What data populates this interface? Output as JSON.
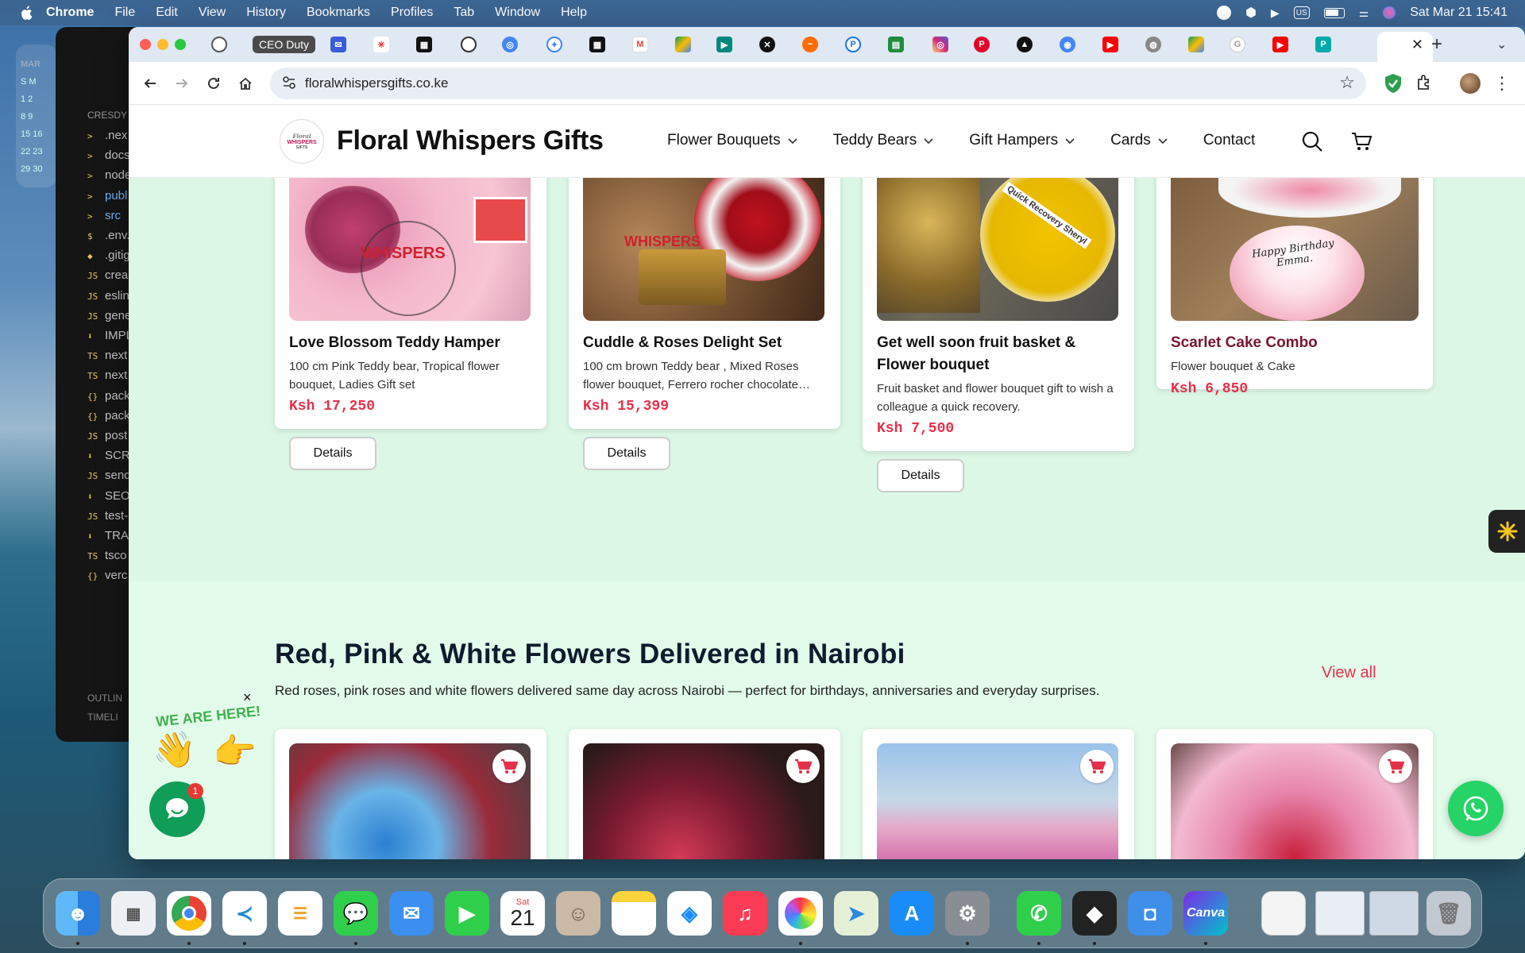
{
  "menubar": {
    "app_name": "Chrome",
    "items": [
      "File",
      "Edit",
      "View",
      "History",
      "Bookmarks",
      "Profiles",
      "Tab",
      "Window",
      "Help"
    ],
    "clock": "Sat Mar 21  15:41",
    "input_source": "US"
  },
  "editor_window": {
    "section_label": "CRESDY",
    "files": [
      {
        "tag": ">",
        "name": ".nex"
      },
      {
        "tag": ">",
        "name": "docs"
      },
      {
        "tag": ">",
        "name": "node"
      },
      {
        "tag": ">",
        "name": "publ"
      },
      {
        "tag": ">",
        "name": "src"
      },
      {
        "tag": "$",
        "name": ".env."
      },
      {
        "tag": "◆",
        "name": ".gitig"
      },
      {
        "tag": "JS",
        "name": "crea"
      },
      {
        "tag": "JS",
        "name": "eslin"
      },
      {
        "tag": "JS",
        "name": "gene"
      },
      {
        "tag": "⬇",
        "name": "IMPL"
      },
      {
        "tag": "TS",
        "name": "next"
      },
      {
        "tag": "TS",
        "name": "next"
      },
      {
        "tag": "{}",
        "name": "pack"
      },
      {
        "tag": "{}",
        "name": "pack"
      },
      {
        "tag": "JS",
        "name": "post"
      },
      {
        "tag": "⬇",
        "name": "SCR"
      },
      {
        "tag": "JS",
        "name": "send"
      },
      {
        "tag": "⬇",
        "name": "SEO"
      },
      {
        "tag": "JS",
        "name": "test-"
      },
      {
        "tag": "⬇",
        "name": "TRA"
      },
      {
        "tag": "TS",
        "name": "tsco"
      },
      {
        "tag": "{}",
        "name": "verc"
      }
    ],
    "outline_label": "OUTLIN",
    "timeline_label": "TIMELI"
  },
  "calendar_widget": {
    "month": "MAR",
    "rows": [
      "S M",
      "1 2",
      "8 9",
      "15 16",
      "22 23",
      "29 30"
    ]
  },
  "browser": {
    "pinned_tab_label": "CEO Duty",
    "url": "floralwhispersgifts.co.ke"
  },
  "site": {
    "logo_text": "WHISPERS",
    "logo_script": "Floral",
    "logo_sub": "GIFTS",
    "title": "Floral Whispers Gifts",
    "nav": [
      {
        "label": "Flower Bouquets",
        "has_dropdown": true
      },
      {
        "label": "Teddy Bears",
        "has_dropdown": true
      },
      {
        "label": "Gift Hampers",
        "has_dropdown": true
      },
      {
        "label": "Cards",
        "has_dropdown": true
      },
      {
        "label": "Contact",
        "has_dropdown": false
      }
    ]
  },
  "products": [
    {
      "name": "Love Blossom Teddy Hamper",
      "desc": "100 cm Pink Teddy bear, Tropical flower bouquet, Ladies Gift set",
      "price": "Ksh 17,250",
      "button": "Details",
      "image_text": "WHISPERS"
    },
    {
      "name": "Cuddle & Roses Delight Set",
      "desc": "100 cm brown Teddy bear , Mixed Roses flower bouquet, Ferrero rocher chocolate…",
      "price": "Ksh 15,399",
      "button": "Details",
      "image_text": "WHISPERS"
    },
    {
      "name": "Get well soon fruit basket & Flower bouquet",
      "desc": "Fruit basket and flower bouquet gift to wish a colleague a quick recovery.",
      "price": "Ksh 7,500",
      "button": "Details",
      "image_text": "Quick Recovery Sheryl"
    },
    {
      "name": "Scarlet Cake Combo",
      "desc": "Flower bouquet & Cake",
      "price": "Ksh 6,850",
      "image_text": "Happy Birthday Emma."
    }
  ],
  "section2": {
    "title": "Red, Pink & White Flowers Delivered in Nairobi",
    "subtitle": "Red roses, pink roses and white flowers delivered same day across Nairobi — perfect for birthdays, anniversaries and everyday surprises.",
    "view_all": "View all"
  },
  "widgets": {
    "we_are_here": "WE ARE HERE!",
    "chat_badge": "1",
    "close": "×"
  },
  "dock": {
    "calendar_day": "Sat",
    "calendar_date": "21",
    "canva_label": "Canva"
  },
  "colors": {
    "accent_red": "#e5304a",
    "green_bg": "#dcf7e6",
    "whatsapp": "#25d366"
  }
}
